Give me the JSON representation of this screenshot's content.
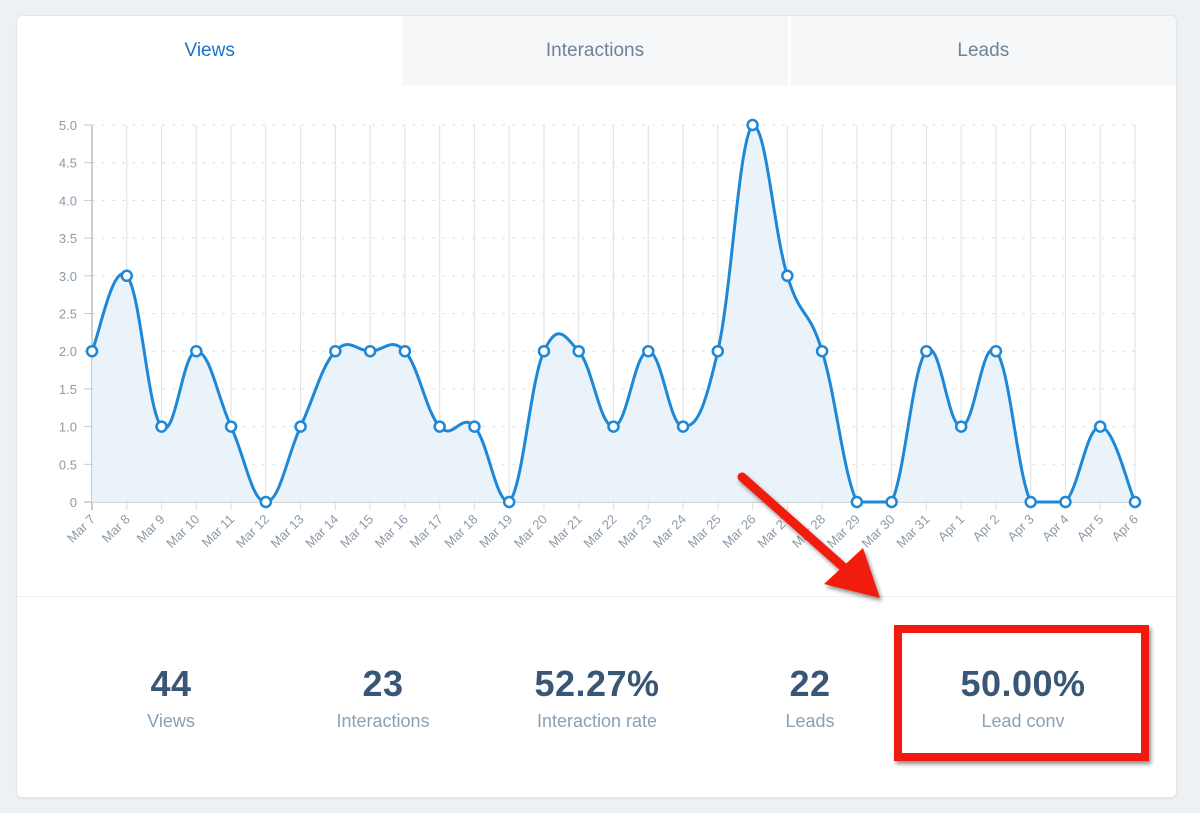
{
  "tabs": [
    {
      "label": "Views",
      "active": true
    },
    {
      "label": "Interactions",
      "active": false
    },
    {
      "label": "Leads",
      "active": false
    }
  ],
  "colors": {
    "accent": "#1a73c9",
    "line": "#1e88d6",
    "fill": "#e8f1fa",
    "annotation": "#f21a0f",
    "stat_value": "#3a5676",
    "stat_label": "#8aa1b5"
  },
  "chart_data": {
    "type": "area",
    "title": "",
    "xlabel": "",
    "ylabel": "",
    "ylim": [
      0,
      5
    ],
    "yticks": [
      "0",
      "0.5",
      "1.0",
      "1.5",
      "2.0",
      "2.5",
      "3.0",
      "3.5",
      "4.0",
      "4.5",
      "5.0"
    ],
    "grid": true,
    "smooth": true,
    "categories": [
      "Mar 7",
      "Mar 8",
      "Mar 9",
      "Mar 10",
      "Mar 11",
      "Mar 12",
      "Mar 13",
      "Mar 14",
      "Mar 15",
      "Mar 16",
      "Mar 17",
      "Mar 18",
      "Mar 19",
      "Mar 20",
      "Mar 21",
      "Mar 22",
      "Mar 23",
      "Mar 24",
      "Mar 25",
      "Mar 26",
      "Mar 27",
      "Mar 28",
      "Mar 29",
      "Mar 30",
      "Mar 31",
      "Apr 1",
      "Apr 2",
      "Apr 3",
      "Apr 4",
      "Apr 5",
      "Apr 6"
    ],
    "series": [
      {
        "name": "Views",
        "values": [
          2,
          3,
          1,
          2,
          1,
          0,
          1,
          2,
          2,
          2,
          1,
          1,
          0,
          2,
          2,
          1,
          2,
          1,
          2,
          5,
          3,
          2,
          0,
          0,
          2,
          1,
          2,
          0,
          0,
          1,
          0
        ]
      }
    ]
  },
  "stats": [
    {
      "value": "44",
      "label": "Views"
    },
    {
      "value": "23",
      "label": "Interactions"
    },
    {
      "value": "52.27%",
      "label": "Interaction rate"
    },
    {
      "value": "22",
      "label": "Leads"
    },
    {
      "value": "50.00%",
      "label": "Lead conv"
    }
  ],
  "annotation": {
    "highlighted_stat": "Lead conv",
    "arrow_icon": "red-arrow-icon"
  }
}
